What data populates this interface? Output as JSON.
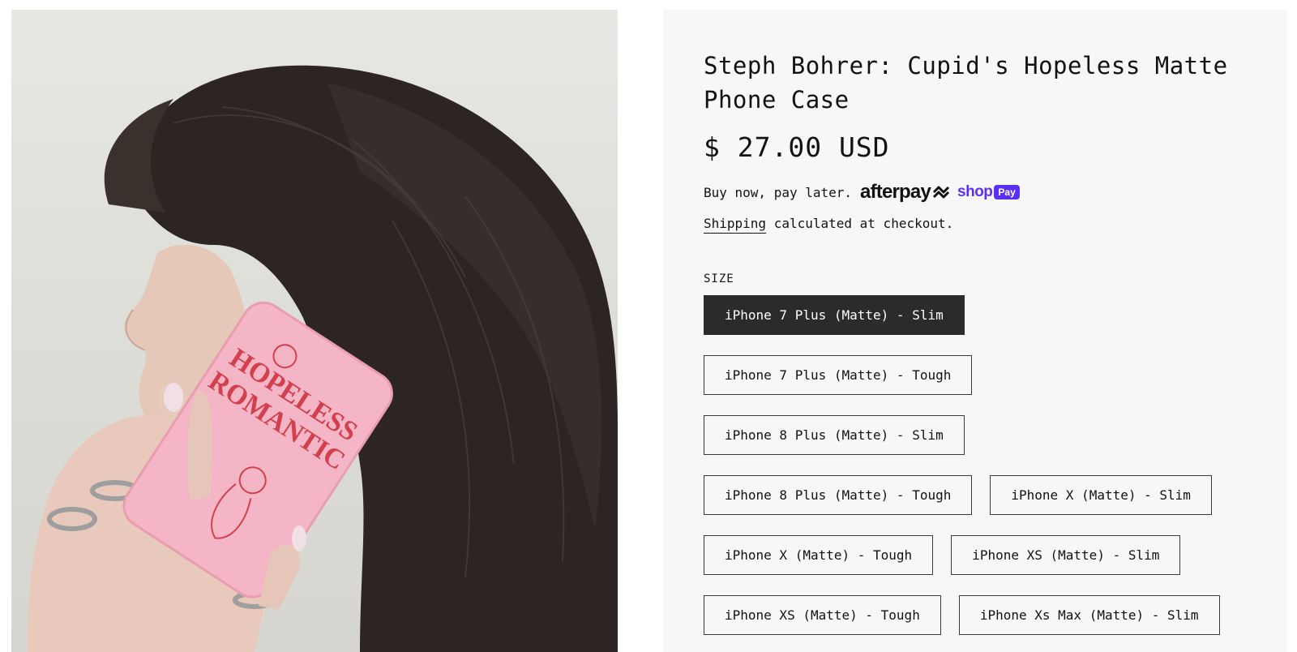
{
  "product": {
    "title": "Steph Bohrer: Cupid's Hopeless Matte Phone Case",
    "price": "$ 27.00 USD",
    "image_alt": "Model holding pink Hopeless Romantic phone case",
    "case_print": "HOPELESS ROMANTIC"
  },
  "payment": {
    "pay_later_text": "Buy now, pay later.",
    "afterpay_label": "afterpay",
    "shoppay_label": "shop",
    "shoppay_pill": "Pay"
  },
  "shipping": {
    "link_label": "Shipping",
    "rest": " calculated at checkout."
  },
  "size": {
    "label": "SIZE",
    "selected": "iPhone 7 Plus (Matte) - Slim",
    "rows": [
      [
        "iPhone 7 Plus (Matte) - Slim"
      ],
      [
        "iPhone 7 Plus (Matte) - Tough"
      ],
      [
        "iPhone 8 Plus (Matte) - Slim"
      ],
      [
        "iPhone 8 Plus (Matte) - Tough",
        "iPhone X (Matte) - Slim"
      ],
      [
        "iPhone X (Matte) - Tough",
        "iPhone XS (Matte) - Slim"
      ],
      [
        "iPhone XS (Matte) - Tough",
        "iPhone Xs Max (Matte) - Slim"
      ]
    ]
  },
  "colors": {
    "selected_bg": "#2b2b2b",
    "panel_bg": "#f7f7f7",
    "shoppay": "#5a31f4",
    "case_pink": "#f4b6c6",
    "case_print": "#d2404e"
  }
}
